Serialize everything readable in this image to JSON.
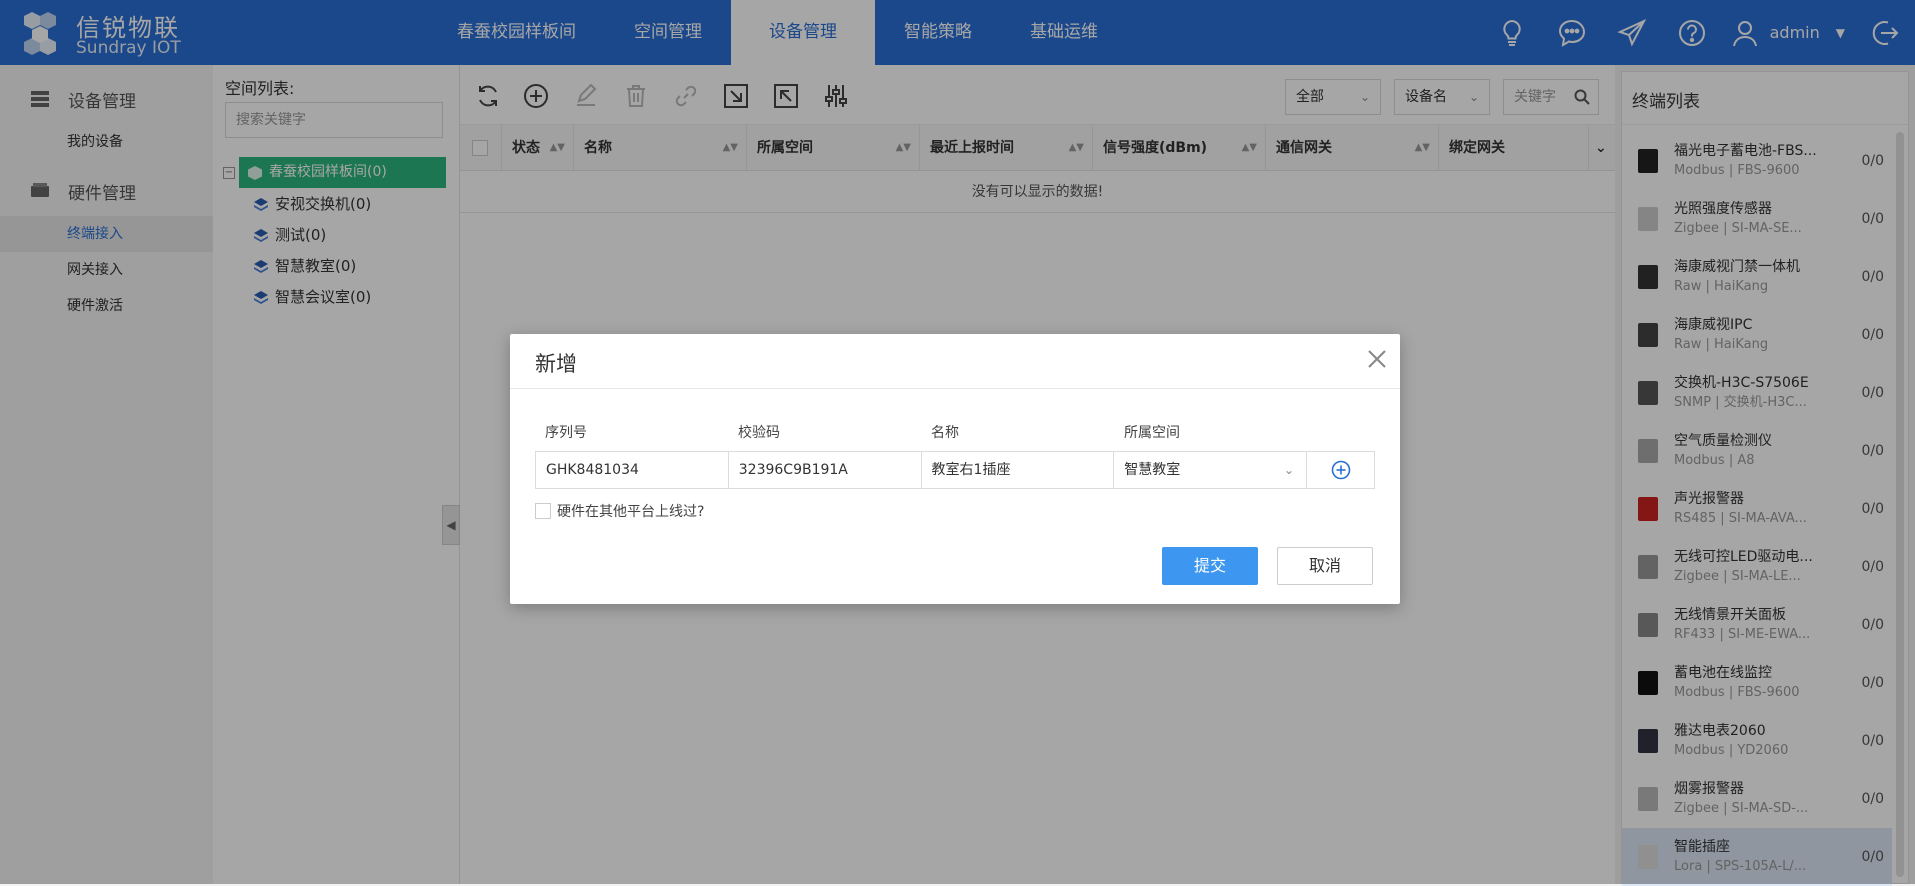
{
  "brand": {
    "name_cn": "信锐物联",
    "name_en": "Sundray IOT"
  },
  "nav": [
    "春蚕校园样板间",
    "空间管理",
    "设备管理",
    "智能策略",
    "基础运维"
  ],
  "user": {
    "name": "admin"
  },
  "sidebar": {
    "groups": [
      {
        "label": "设备管理",
        "items": [
          "我的设备"
        ]
      },
      {
        "label": "硬件管理",
        "items": [
          "终端接入",
          "网关接入",
          "硬件激活"
        ]
      }
    ],
    "active_item": "终端接入"
  },
  "spaces": {
    "title": "空间列表:",
    "search_placeholder": "搜索关键字",
    "root": "春蚕校园样板间(0)",
    "children": [
      "安视交换机(0)",
      "测试(0)",
      "智慧教室(0)",
      "智慧会议室(0)"
    ]
  },
  "toolbar": {
    "filter_scope": "全部",
    "filter_field": "设备名",
    "keyword_placeholder": "关键字"
  },
  "grid": {
    "columns": [
      "状态",
      "名称",
      "所属空间",
      "最近上报时间",
      "信号强度(dBm)",
      "通信网关",
      "绑定网关"
    ],
    "empty_text": "没有可以显示的数据!"
  },
  "terminals": {
    "title": "终端列表",
    "items": [
      {
        "name": "福光电子蓄电池-FBS...",
        "sub": "Modbus | FBS-9600",
        "count": "0/0"
      },
      {
        "name": "光照强度传感器",
        "sub": "Zigbee | SI-MA-SE...",
        "count": "0/0"
      },
      {
        "name": "海康威视门禁一体机",
        "sub": "Raw | HaiKang",
        "count": "0/0"
      },
      {
        "name": "海康威视IPC",
        "sub": "Raw | HaiKang",
        "count": "0/0"
      },
      {
        "name": "交换机-H3C-S7506E",
        "sub": "SNMP | 交换机-H3C...",
        "count": "0/0"
      },
      {
        "name": "空气质量检测仪",
        "sub": "Modbus | A8",
        "count": "0/0"
      },
      {
        "name": "声光报警器",
        "sub": "RS485 | SI-MA-AVA...",
        "count": "0/0"
      },
      {
        "name": "无线可控LED驱动电...",
        "sub": "Zigbee | SI-MA-LE...",
        "count": "0/0"
      },
      {
        "name": "无线情景开关面板",
        "sub": "RF433 | SI-ME-EWA...",
        "count": "0/0"
      },
      {
        "name": "蓄电池在线监控",
        "sub": "Modbus | FBS-9600",
        "count": "0/0"
      },
      {
        "name": "雅达电表2060",
        "sub": "Modbus | YD2060",
        "count": "0/0"
      },
      {
        "name": "烟雾报警器",
        "sub": "Zigbee | SI-MA-SD-...",
        "count": "0/0"
      },
      {
        "name": "智能插座",
        "sub": "Lora | SPS-105A-L/...",
        "count": "0/0"
      }
    ]
  },
  "dialog": {
    "title": "新增",
    "columns": [
      "序列号",
      "校验码",
      "名称",
      "所属空间"
    ],
    "row": {
      "serial": "GHK8481034",
      "check_code": "32396C9B191A",
      "name": "教室右1插座",
      "space": "智慧教室"
    },
    "checkbox_label": "硬件在其他平台上线过?",
    "submit_label": "提交",
    "cancel_label": "取消"
  }
}
